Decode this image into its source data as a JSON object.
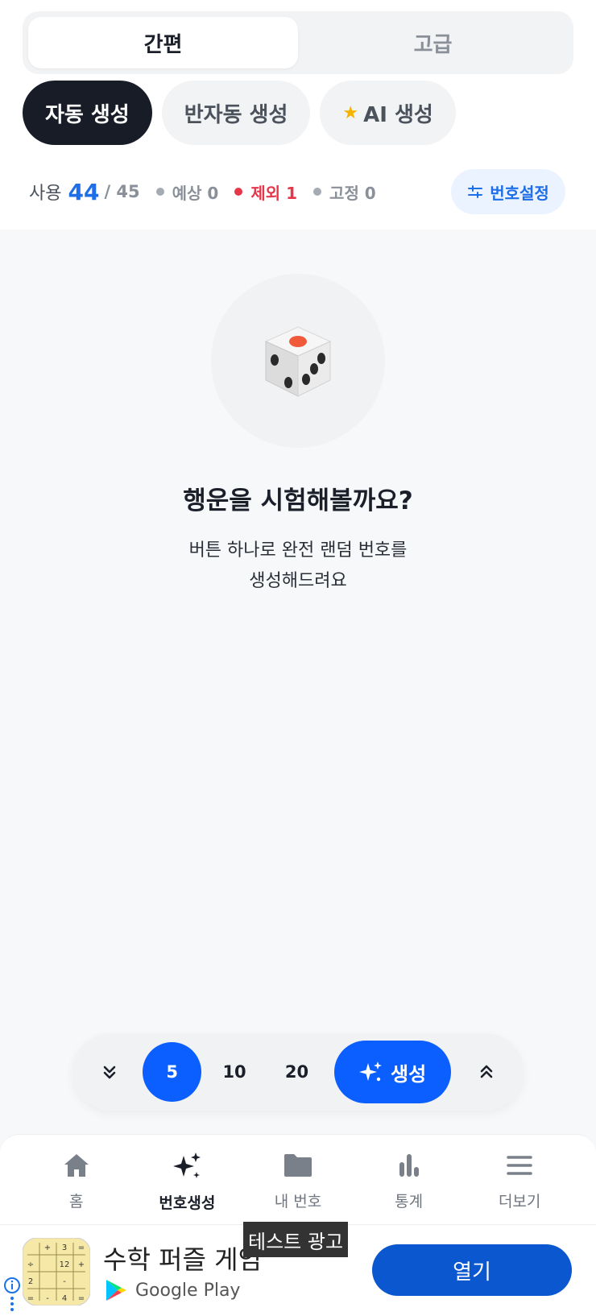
{
  "mode_toggle": {
    "simple": "간편",
    "advanced": "고급",
    "selected": "간편"
  },
  "gen_tabs": {
    "auto": "자동 생성",
    "semi": "반자동 생성",
    "ai": "AI 생성",
    "selected": "자동 생성"
  },
  "stats": {
    "use_label": "사용",
    "use_count": "44",
    "use_total": "/ 45",
    "predicted": "예상 0",
    "excluded": "제외 1",
    "fixed": "고정 0"
  },
  "settings_button": "번호설정",
  "empty_state": {
    "title": "행운을 시험해볼까요?",
    "desc_line1": "버튼 하나로 완전 랜덤 번호를",
    "desc_line2": "생성해드려요"
  },
  "controls": {
    "counts": [
      "5",
      "10",
      "20"
    ],
    "selected_count": "5",
    "generate": "생성"
  },
  "nav": {
    "home": "홈",
    "generate": "번호생성",
    "my_numbers": "내 번호",
    "stats": "통계",
    "more": "더보기",
    "active": "번호생성"
  },
  "ad": {
    "label": "테스트 광고",
    "title": "수학 퍼즐 게임",
    "store": "Google Play",
    "open": "열기",
    "icon_tiles": [
      "+",
      "3",
      "=",
      "÷",
      "2",
      "12",
      "+",
      "=",
      "-",
      "-",
      "4",
      "="
    ]
  },
  "colors": {
    "accent": "#0b5fff",
    "dark": "#171c26",
    "excluded": "#e5364a",
    "ad_button": "#0b57d0"
  }
}
